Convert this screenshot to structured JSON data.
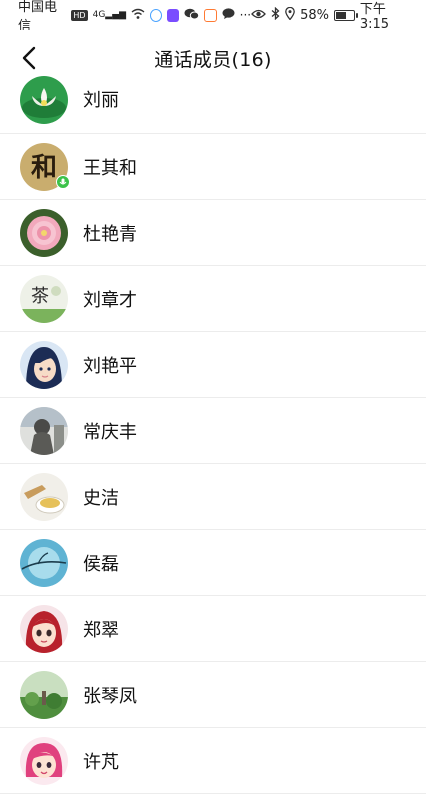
{
  "status_bar": {
    "carrier": "中国电信",
    "hd_badge": "HD",
    "signal": "4G",
    "battery_percent": "58%",
    "battery_level": 0.58,
    "time": "下午3:15",
    "icons": [
      "wifi-icon",
      "app-icon",
      "wechat-icon",
      "message-icon",
      "more-icon",
      "eye-icon",
      "bluetooth-icon",
      "location-icon"
    ]
  },
  "header": {
    "title": "通话成员(16)",
    "back_icon": "chevron-left-icon"
  },
  "members": [
    {
      "name": "刘丽",
      "avatar": "lotus-flower",
      "speaking": false
    },
    {
      "name": "王其和",
      "avatar": "calligraphy-he",
      "speaking": true
    },
    {
      "name": "杜艳青",
      "avatar": "pink-rose",
      "speaking": false
    },
    {
      "name": "刘章才",
      "avatar": "tea-character",
      "speaking": false
    },
    {
      "name": "刘艳平",
      "avatar": "cartoon-girl",
      "speaking": false
    },
    {
      "name": "常庆丰",
      "avatar": "sculpture",
      "speaking": false
    },
    {
      "name": "史洁",
      "avatar": "tea-cup",
      "speaking": false
    },
    {
      "name": "侯磊",
      "avatar": "blue-branch",
      "speaking": false
    },
    {
      "name": "郑翠",
      "avatar": "cartoon-redhead",
      "speaking": false
    },
    {
      "name": "张琴凤",
      "avatar": "lotus-pond",
      "speaking": false
    },
    {
      "name": "许芃",
      "avatar": "cartoon-pink-hair",
      "speaking": false
    }
  ],
  "avatar_glyphs": {
    "calligraphy": "和",
    "tea": "茶"
  },
  "colors": {
    "speaking_badge": "#3cc24a",
    "divider": "#ececec"
  }
}
